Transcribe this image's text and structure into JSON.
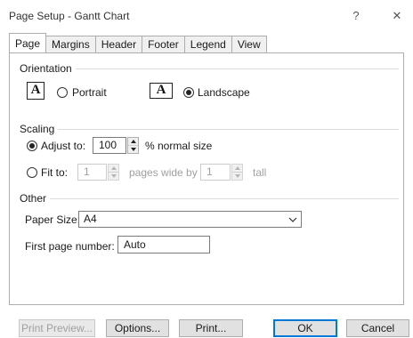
{
  "window": {
    "title": "Page Setup - Gantt Chart",
    "help_glyph": "?",
    "close_glyph": "✕"
  },
  "tabs": [
    {
      "label": "Page",
      "active": true
    },
    {
      "label": "Margins",
      "active": false
    },
    {
      "label": "Header",
      "active": false
    },
    {
      "label": "Footer",
      "active": false
    },
    {
      "label": "Legend",
      "active": false
    },
    {
      "label": "View",
      "active": false
    }
  ],
  "orientation": {
    "group_label": "Orientation",
    "portrait": {
      "icon_letter": "A",
      "label": "Portrait",
      "selected": false
    },
    "landscape": {
      "icon_letter": "A",
      "label": "Landscape",
      "selected": true
    }
  },
  "scaling": {
    "group_label": "Scaling",
    "adjust_to": {
      "label": "Adjust to:",
      "value": "100",
      "suffix": "% normal size",
      "selected": true
    },
    "fit_to": {
      "label": "Fit to:",
      "wide_value": "1",
      "wide_label": "pages wide by",
      "tall_value": "1",
      "tall_label": "tall",
      "selected": false
    }
  },
  "other": {
    "group_label": "Other",
    "paper_size": {
      "label": "Paper Size:",
      "value": "A4"
    },
    "first_page_number": {
      "label": "First page number:",
      "value": "Auto"
    }
  },
  "buttons": {
    "print_preview": "Print Preview...",
    "options": "Options...",
    "print": "Print...",
    "ok": "OK",
    "cancel": "Cancel"
  }
}
